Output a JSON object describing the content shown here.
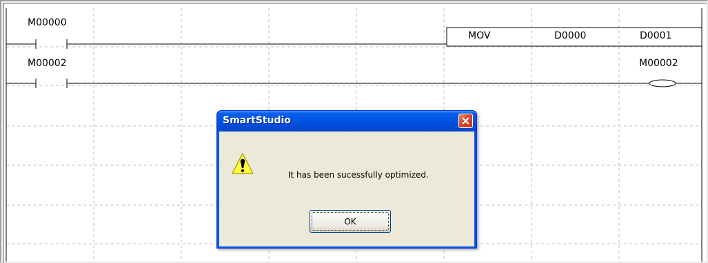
{
  "ladder": {
    "rung1": {
      "contact_label": "M00000",
      "instruction": "MOV",
      "operand_src": "D0000",
      "operand_dst": "D0001"
    },
    "rung2": {
      "contact_label": "M00002",
      "coil_label": "M00002"
    }
  },
  "dialog": {
    "title": "SmartStudio",
    "message": "It has been sucessfully optimized.",
    "ok_label": "OK",
    "icon": "warning-icon",
    "close_icon": "close-icon"
  },
  "colors": {
    "titlebar": "#0055e5",
    "close_button": "#d9462a",
    "dialog_client": "#ece9d8",
    "grid": "#bdbdbd"
  }
}
